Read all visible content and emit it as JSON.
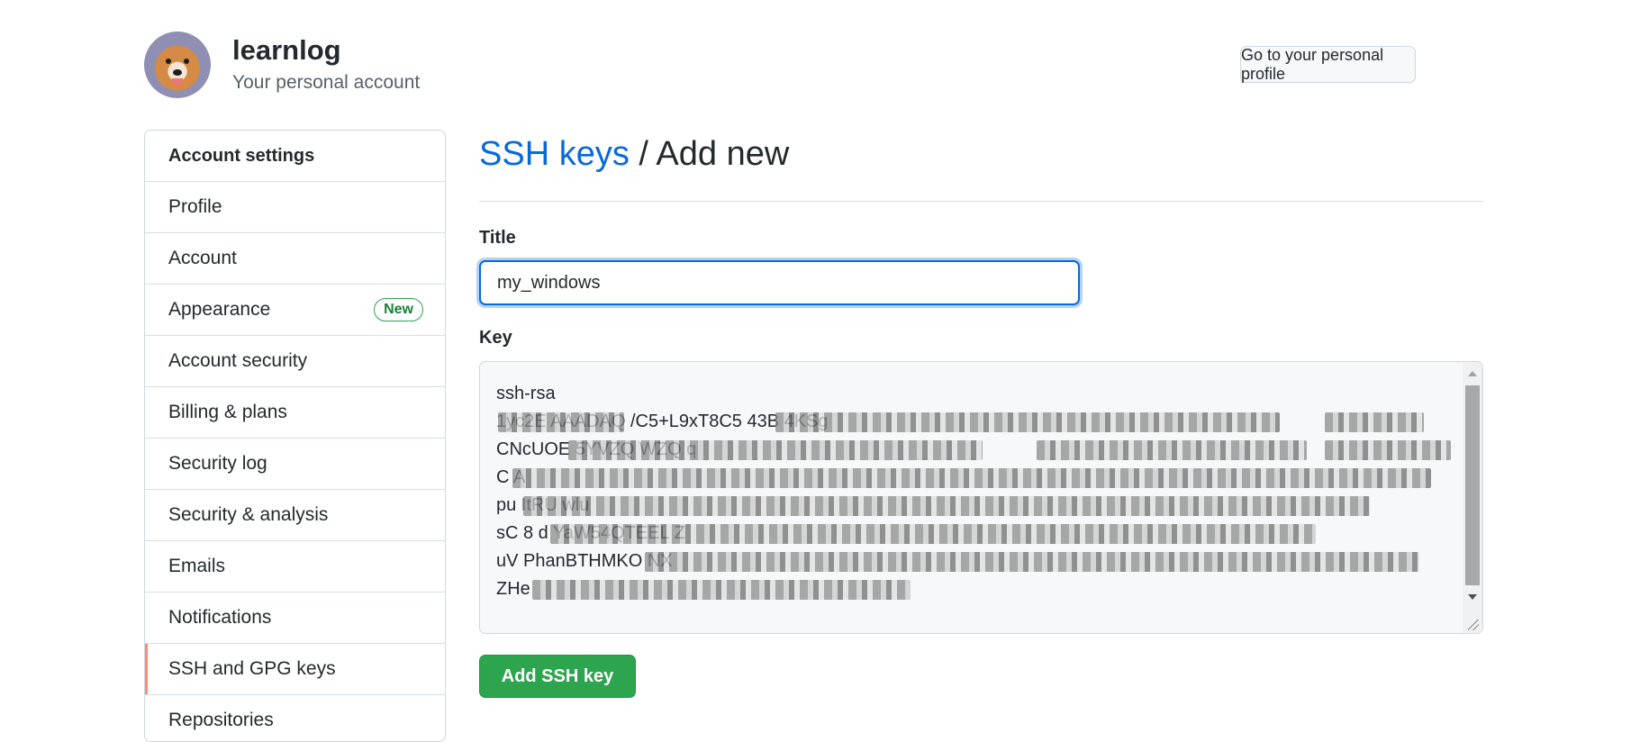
{
  "header": {
    "username": "learnlog",
    "account_type": "Your personal account",
    "profile_button": "Go to your personal profile"
  },
  "sidebar": {
    "heading": "Account settings",
    "items": [
      {
        "label": "Profile"
      },
      {
        "label": "Account"
      },
      {
        "label": "Appearance",
        "badge": "New"
      },
      {
        "label": "Account security"
      },
      {
        "label": "Billing & plans"
      },
      {
        "label": "Security log"
      },
      {
        "label": "Security & analysis"
      },
      {
        "label": "Emails"
      },
      {
        "label": "Notifications"
      },
      {
        "label": "SSH and GPG keys",
        "selected": true
      },
      {
        "label": "Repositories"
      }
    ]
  },
  "main": {
    "breadcrumb_link": "SSH keys",
    "breadcrumb_rest": " / Add new",
    "title_label": "Title",
    "title_value": "my_windows",
    "key_label": "Key",
    "key_lines": [
      "ssh-rsa",
      "1yc2E  AAADAQ                                         /C5+L9xT8C5       43B  4KSg",
      "CNcUOE                                                     5YVZQ                                    WZQ         q",
      "C                                                                                                                       A",
      "pu                                                                                                              ItRU       wlu",
      "sC          8  d                                                                                     YaW54QTEEL  Z",
      "uV   PhanBTHMKO                                                                                                    NX",
      "ZHe"
    ],
    "submit_button": "Add SSH key"
  },
  "colors": {
    "link": "#0969da",
    "primary_button": "#2da44e",
    "selected_indicator": "#fd8c73",
    "badge": "#1a7f37"
  }
}
